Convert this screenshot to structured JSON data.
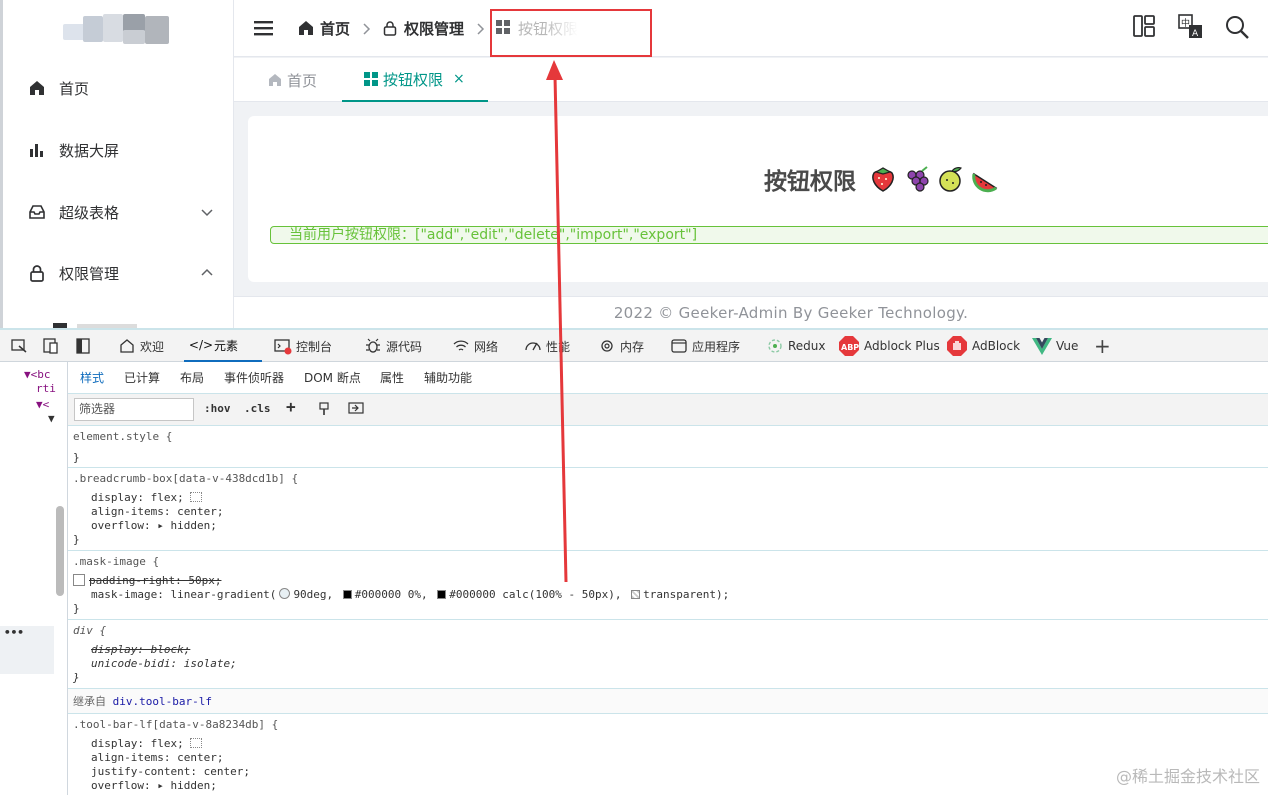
{
  "sidebar": {
    "items": [
      {
        "label": "首页",
        "icon": "home-icon"
      },
      {
        "label": "数据大屏",
        "icon": "bar-chart-icon"
      },
      {
        "label": "超级表格",
        "icon": "inbox-icon",
        "arrow": "chevron-down-icon"
      },
      {
        "label": "权限管理",
        "icon": "lock-icon",
        "arrow": "chevron-up-icon"
      }
    ]
  },
  "header": {
    "breadcrumb": [
      "首页",
      "权限管理",
      "按钮权限"
    ],
    "icons": [
      "layout-icon",
      "translate-icon",
      "search-icon"
    ]
  },
  "tabs": [
    {
      "label": "首页",
      "icon": "home-icon"
    },
    {
      "label": "按钮权限",
      "icon": "grid-icon",
      "close": "×"
    }
  ],
  "main": {
    "title": "按钮权限",
    "permissions_text": "当前用户按钮权限：[\"add\",\"edit\",\"delete\",\"import\",\"export\"]",
    "footer": "2022 © Geeker-Admin By Geeker Technology."
  },
  "devtools": {
    "tabs": [
      "欢迎",
      "元素",
      "控制台",
      "源代码",
      "网络",
      "性能",
      "内存",
      "应用程序",
      "Redux",
      "Adblock Plus",
      "AdBlock",
      "Vue"
    ],
    "subtabs": [
      "样式",
      "已计算",
      "布局",
      "事件侦听器",
      "DOM 断点",
      "属性",
      "辅助功能"
    ],
    "filter_placeholder": "筛选器",
    "hov": ":hov",
    "cls": ".cls",
    "left_code": [
      "<bc",
      "rti",
      "<"
    ],
    "rules": {
      "r1": {
        "selector": "element.style {",
        "close": "}"
      },
      "r2": {
        "selector": ".breadcrumb-box[data-v-438dcd1b] {",
        "d1": "display: flex;",
        "d2": "align-items: center;",
        "d3": "overflow: ",
        "d3v": "hidden;",
        "close": "}"
      },
      "r3": {
        "selector": ".mask-image {",
        "d1": "padding-right: 50px;",
        "d2a": "mask-image: linear-gradient(",
        "d2b": "90deg, ",
        "d2c": "#000000 0%, ",
        "d2d": "#000000 calc(100% - 50px), ",
        "d2e": "transparent);",
        "close": "}"
      },
      "r4": {
        "selector": "div {",
        "d1": "display: block;",
        "d2": "unicode-bidi: isolate;",
        "close": "}"
      },
      "inherit_prefix": "继承自 ",
      "inherit_link": "div.tool-bar-lf",
      "r5": {
        "selector": ".tool-bar-lf[data-v-8a8234db] {",
        "d1": "display: flex;",
        "d2": "align-items: center;",
        "d3": "justify-content: center;",
        "d4": "overflow: ",
        "d4v": "hidden;"
      }
    }
  },
  "watermark": "@稀土掘金技术社区",
  "colors": {
    "accent": "#009688",
    "red_annotation": "#e5383b",
    "tag_green": "#67c23a"
  }
}
